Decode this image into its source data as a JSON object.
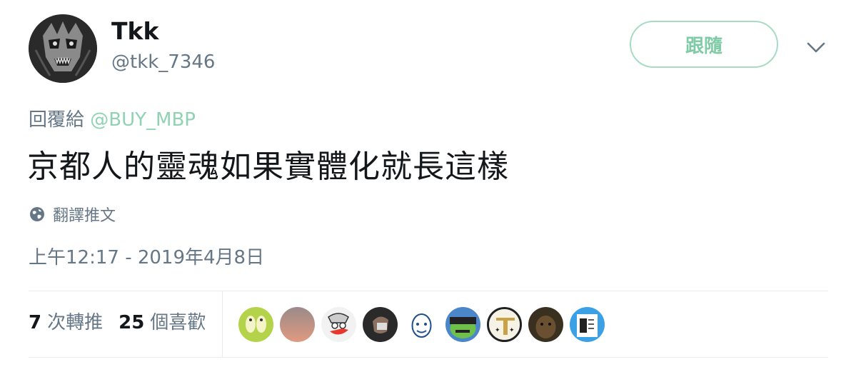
{
  "user": {
    "name": "Tkk",
    "handle": "@tkk_7346"
  },
  "follow_button_label": "跟隨",
  "reply": {
    "prefix": "回覆給",
    "mention": "@BUY_MBP"
  },
  "tweet_text": "京都人的靈魂如果實體化就長這樣",
  "translate_label": "翻譯推文",
  "timestamp": "上午12:17 - 2019年4月8日",
  "stats": {
    "retweets_count": "7",
    "retweets_label": "次轉推",
    "likes_count": "25",
    "likes_label": "個喜歡"
  },
  "colors": {
    "accent": "#7fcba5",
    "follow_border": "#a7dcc4",
    "secondary_text": "#657786",
    "divider": "#e6ecf0"
  },
  "icons": {
    "caret": "chevron-down-icon",
    "translate": "globe-icon"
  }
}
